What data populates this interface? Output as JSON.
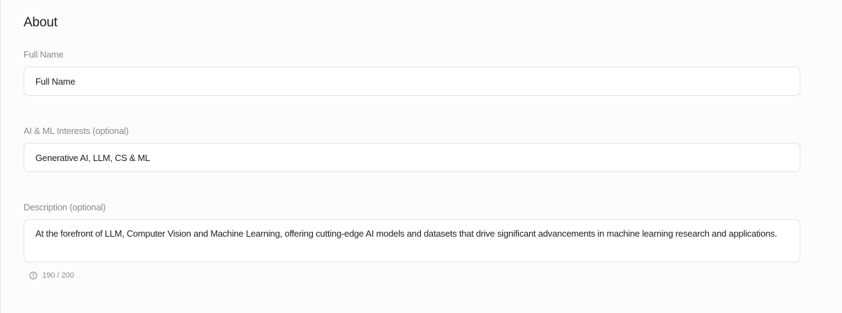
{
  "about": {
    "title": "About",
    "full_name": {
      "label": "Full Name",
      "value": "Full Name"
    },
    "interests": {
      "label": "AI & ML Interests (optional)",
      "value": "Generative AI, LLM, CS & ML"
    },
    "description": {
      "label": "Description (optional)",
      "value": "At the forefront of LLM, Computer Vision and Machine Learning, offering cutting-edge AI models and datasets that drive significant advancements in machine learning research and applications.",
      "counter": "190 / 200"
    }
  },
  "icons": {
    "counter_icon": "info-circle-icon"
  },
  "colors": {
    "background": "#fcfcfc",
    "border": "#e3e3e3",
    "label": "#8a8a8a",
    "text": "#1f1f1f"
  }
}
